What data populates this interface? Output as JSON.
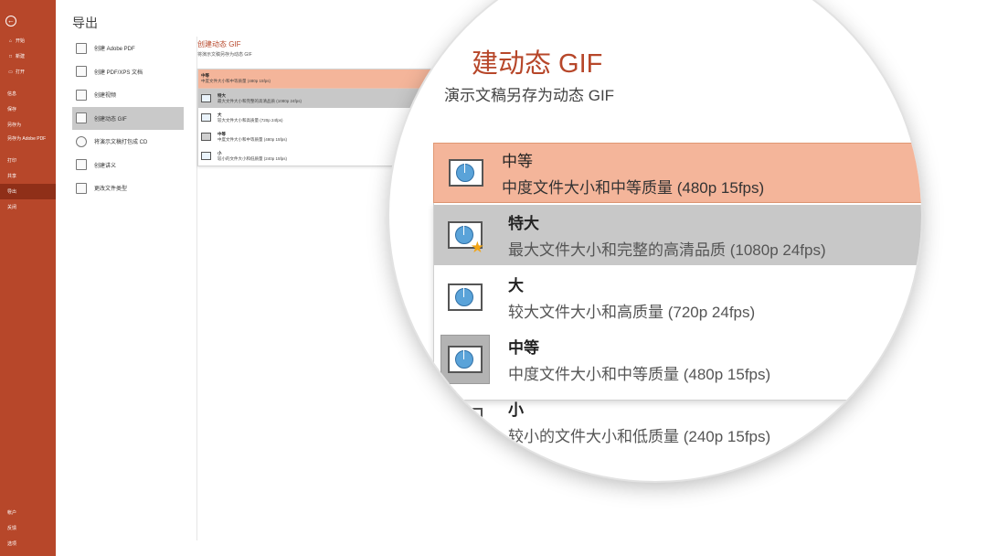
{
  "sidebar": {
    "back_glyph": "←",
    "items_top": [
      {
        "label": "开始",
        "icon": "home-icon",
        "glyph": "⌂"
      },
      {
        "label": "新建",
        "icon": "new-file-icon",
        "glyph": "□"
      },
      {
        "label": "打开",
        "icon": "folder-icon",
        "glyph": "▭"
      }
    ],
    "items_mid": [
      {
        "label": "信息"
      },
      {
        "label": "保存"
      },
      {
        "label": "另存为"
      },
      {
        "label": "另存为 Adobe PDF"
      },
      {
        "label": "打印"
      },
      {
        "label": "共享"
      },
      {
        "label": "导出"
      },
      {
        "label": "关闭"
      }
    ],
    "items_bottom": [
      {
        "label": "帐户"
      },
      {
        "label": "反馈"
      },
      {
        "label": "选项"
      }
    ],
    "active": "导出",
    "color": "#b7472a"
  },
  "export": {
    "title": "导出",
    "options": [
      {
        "label": "创建 Adobe PDF",
        "icon": "adobe-pdf-icon"
      },
      {
        "label": "创建 PDF/XPS 文档",
        "icon": "pdf-xps-icon"
      },
      {
        "label": "创建视频",
        "icon": "video-icon"
      },
      {
        "label": "创建动态 GIF",
        "icon": "gif-icon"
      },
      {
        "label": "将演示文稿打包成 CD",
        "icon": "cd-icon"
      },
      {
        "label": "创建讲义",
        "icon": "handout-icon"
      },
      {
        "label": "更改文件类型",
        "icon": "file-type-icon"
      }
    ],
    "active_option": "创建动态 GIF"
  },
  "gif": {
    "title": "创建动态 GIF",
    "subtitle": "将演示文稿另存为动态 GIF",
    "selected": {
      "name": "中等",
      "desc": "中度文件大小和中等质量 (480p 15fps)"
    },
    "options": [
      {
        "name": "特大",
        "desc": "最大文件大小和完整的高清品质 (1080p 24fps)",
        "state": "hover"
      },
      {
        "name": "大",
        "desc": "较大文件大小和高质量 (720p 24fps)"
      },
      {
        "name": "中等",
        "desc": "中度文件大小和中等质量 (480p 15fps)",
        "state": "current"
      },
      {
        "name": "小",
        "desc": "较小的文件大小和低质量 (240p 15fps)"
      }
    ],
    "magnified_title": "建动态 GIF",
    "magnified_subtitle": "演示文稿另存为动态 GIF",
    "accent": "#f4b59a"
  }
}
